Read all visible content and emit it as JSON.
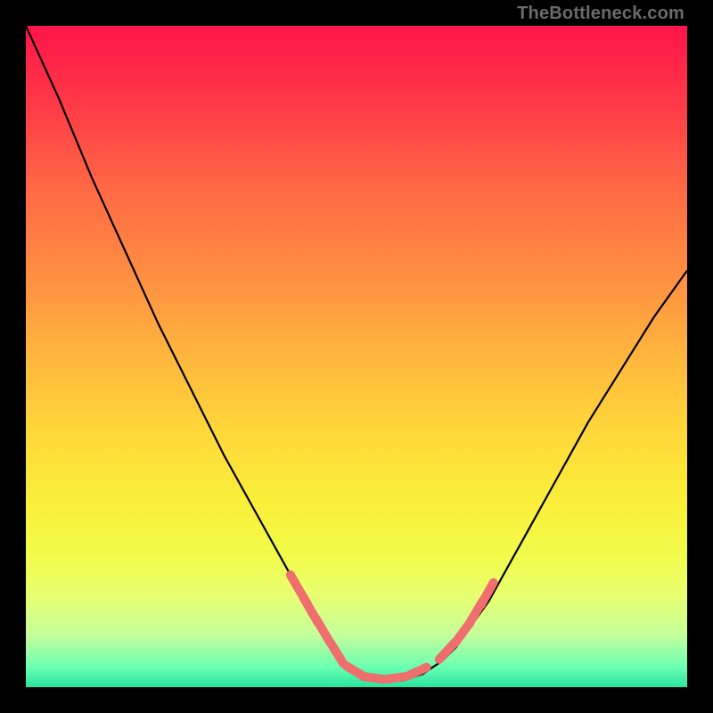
{
  "watermark": "TheBottleneck.com",
  "gradient": {
    "stops": [
      {
        "pct": 0,
        "color": "#ff1449"
      },
      {
        "pct": 12,
        "color": "#ff3a47"
      },
      {
        "pct": 25,
        "color": "#ff6a45"
      },
      {
        "pct": 38,
        "color": "#ff8f42"
      },
      {
        "pct": 50,
        "color": "#ffb63e"
      },
      {
        "pct": 62,
        "color": "#ffd93a"
      },
      {
        "pct": 72,
        "color": "#f9ef3a"
      },
      {
        "pct": 80,
        "color": "#f2fb4a"
      },
      {
        "pct": 86,
        "color": "#e8ff70"
      },
      {
        "pct": 92,
        "color": "#c6ff9a"
      },
      {
        "pct": 97,
        "color": "#6bffb2"
      },
      {
        "pct": 100,
        "color": "#28e59e"
      }
    ]
  },
  "chart_data": {
    "type": "line",
    "title": "",
    "xlabel": "",
    "ylabel": "",
    "xlim": [
      0,
      100
    ],
    "ylim": [
      0,
      100
    ],
    "series": [
      {
        "name": "bottleneck-curve",
        "x": [
          0,
          5,
          10,
          15,
          20,
          25,
          30,
          35,
          40,
          45,
          47,
          50,
          53,
          55,
          57,
          60,
          63,
          65,
          70,
          75,
          80,
          85,
          90,
          95,
          100
        ],
        "y": [
          100,
          89,
          77,
          66,
          55,
          45,
          35,
          26,
          17,
          8,
          5,
          2,
          1,
          1,
          1,
          2,
          4,
          6,
          13,
          22,
          31,
          40,
          48,
          56,
          63
        ]
      }
    ],
    "markers": {
      "name": "highlight-dashes",
      "color": "#ef6e6e",
      "segments": [
        {
          "x": 40.0,
          "y": 17.0,
          "dx": 2.6,
          "dy": -4.5
        },
        {
          "x": 42.0,
          "y": 13.5,
          "dx": 2.2,
          "dy": -3.8
        },
        {
          "x": 43.8,
          "y": 10.5,
          "dx": 2.0,
          "dy": -3.4
        },
        {
          "x": 46.0,
          "y": 6.8,
          "dx": 2.0,
          "dy": -3.2
        },
        {
          "x": 48.5,
          "y": 3.2,
          "dx": 2.5,
          "dy": -1.5
        },
        {
          "x": 51.0,
          "y": 1.6,
          "dx": 3.0,
          "dy": -0.4
        },
        {
          "x": 54.5,
          "y": 1.2,
          "dx": 3.0,
          "dy": 0.4
        },
        {
          "x": 58.0,
          "y": 1.8,
          "dx": 2.6,
          "dy": 1.2
        },
        {
          "x": 62.5,
          "y": 4.2,
          "dx": 2.4,
          "dy": 2.6
        },
        {
          "x": 65.0,
          "y": 6.8,
          "dx": 2.2,
          "dy": 3.0
        },
        {
          "x": 67.0,
          "y": 9.5,
          "dx": 2.0,
          "dy": 3.4
        },
        {
          "x": 68.8,
          "y": 12.4,
          "dx": 1.9,
          "dy": 3.4
        }
      ]
    }
  }
}
